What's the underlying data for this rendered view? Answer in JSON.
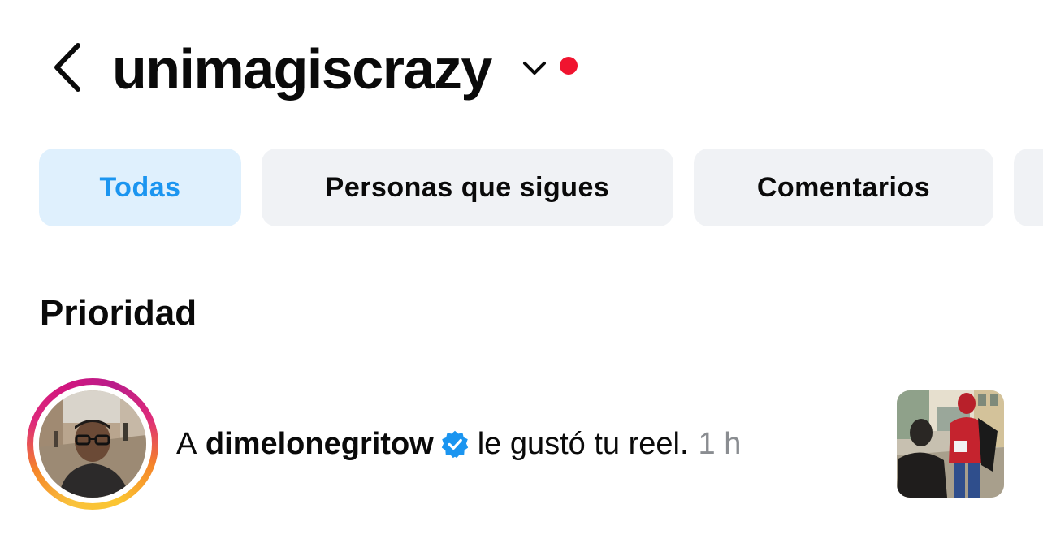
{
  "header": {
    "account_name": "unimagiscrazy",
    "back_icon": "chevron-left-icon",
    "switcher_icon": "chevron-down-icon",
    "notification_dot_color": "#f0142f"
  },
  "filters": {
    "chips": [
      {
        "label": "Todas",
        "active": true
      },
      {
        "label": "Personas que sigues",
        "active": false
      },
      {
        "label": "Comentarios",
        "active": false
      }
    ],
    "active_color": "#1b95f0"
  },
  "section": {
    "title": "Prioridad"
  },
  "notification": {
    "prefix": "A",
    "username": "dimelonegritow",
    "verified": true,
    "verified_color": "#1b95f0",
    "action": "le gustó tu reel.",
    "time": "1 h"
  }
}
